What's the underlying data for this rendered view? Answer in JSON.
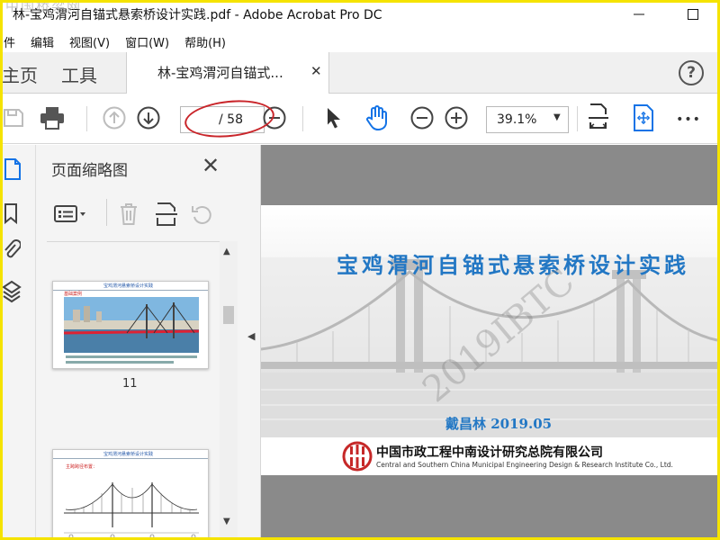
{
  "window": {
    "title": "林-宝鸡渭河自锚式悬索桥设计实践.pdf - Adobe Acrobat Pro DC",
    "minimize_icon": "minimize-icon",
    "maximize_icon": "maximize-icon"
  },
  "watermark_corner": "中国桥梁网",
  "menu": [
    "件",
    "编辑",
    "视图(V)",
    "窗口(W)",
    "帮助(H)"
  ],
  "tabs": {
    "home": "主页",
    "tools": "工具",
    "document": "林-宝鸡渭河自锚式...",
    "close": "✕",
    "help": "?"
  },
  "toolbar": {
    "page_total": "/ 58",
    "zoom": "39.1%",
    "more": "•••",
    "annotation_color": "#c9252a"
  },
  "thumbnails_panel": {
    "title": "页面缩略图",
    "close": "✕",
    "thumbnail_11": {
      "number": "11",
      "header": "宝鸡渭河悬索桥设计实践",
      "caption": "基础案例"
    },
    "thumbnail_12": {
      "header": "宝鸡渭河悬索桥设计实践",
      "subheading": "主跨跨径布置："
    }
  },
  "document_page": {
    "title": "宝鸡渭河自锚式悬索桥设计实践",
    "author_date": "戴昌林   2019.05",
    "organization_cn": "中国市政工程中南设计研究总院有限公司",
    "organization_en": "Central and Southern China Municipal Engineering Design & Research Institute Co., Ltd.",
    "watermark": "2019IBTC",
    "title_color": "#2277c4",
    "logo_color": "#c62828"
  },
  "colors": {
    "frame": "#f5e300",
    "icon_blue": "#1473e6",
    "doc_background": "#8a8a8a"
  }
}
